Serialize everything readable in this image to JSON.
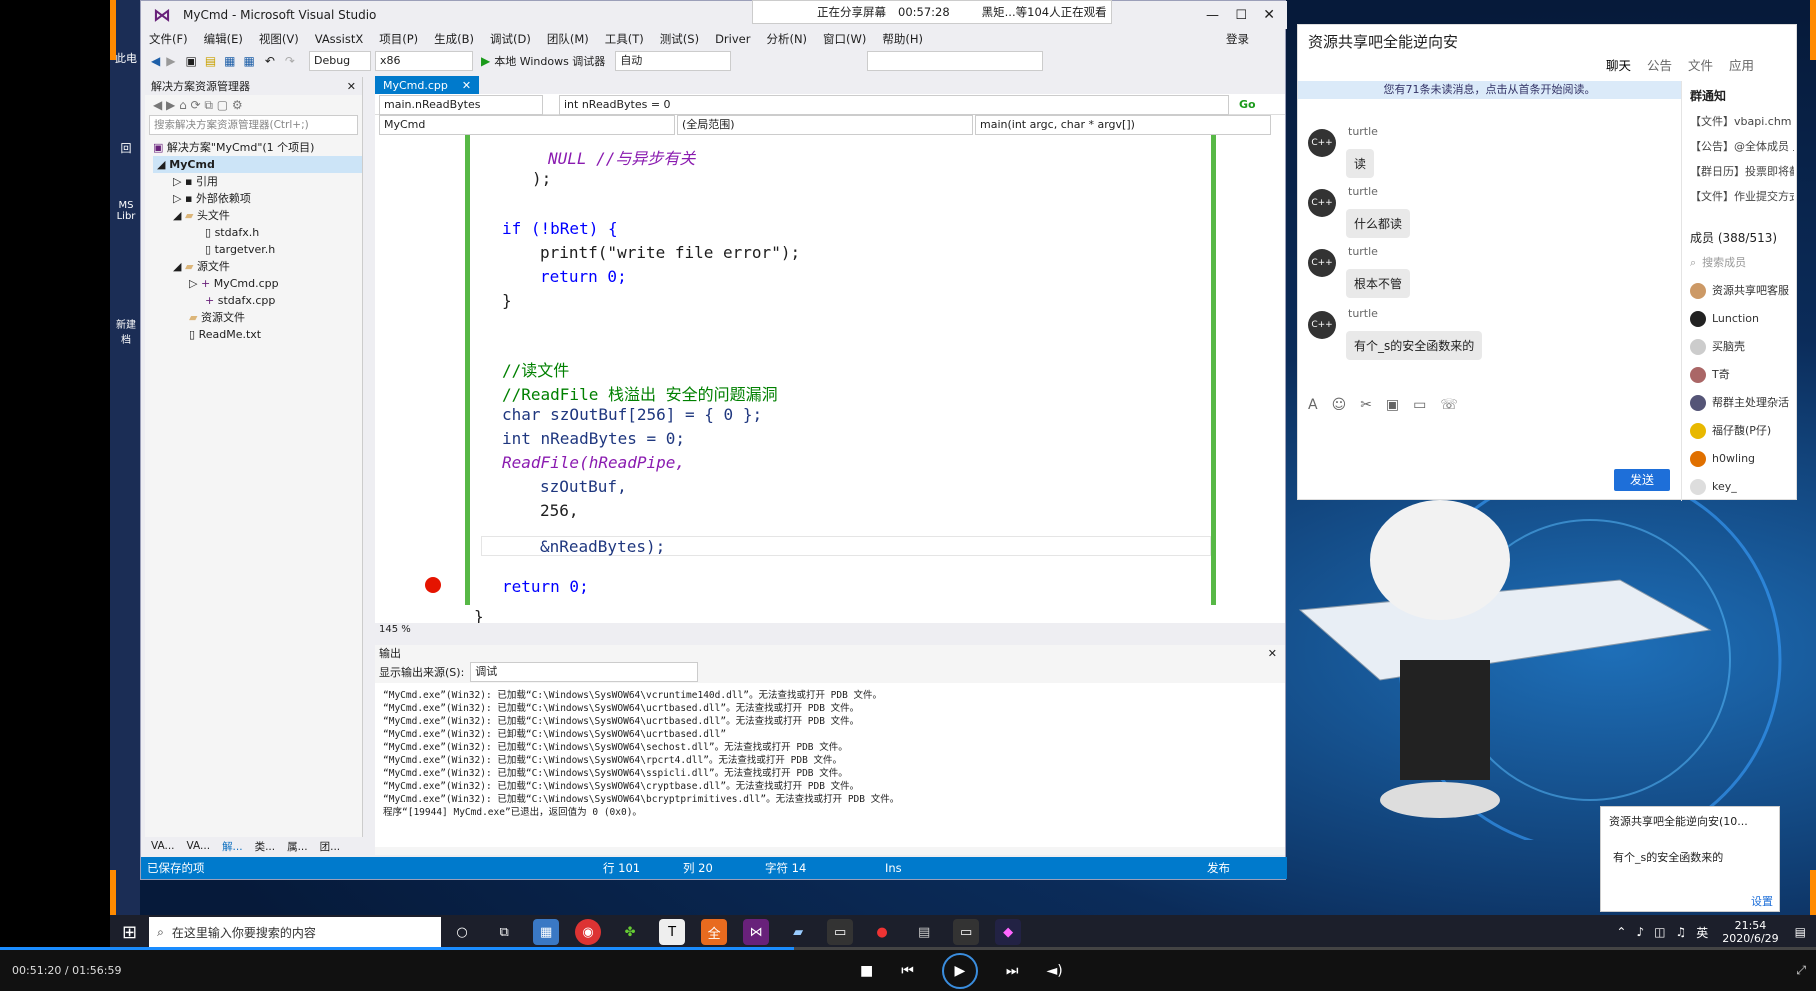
{
  "vs": {
    "title": "MyCmd - Microsoft Visual Studio",
    "menu": [
      "文件(F)",
      "编辑(E)",
      "视图(V)",
      "VAssistX",
      "项目(P)",
      "生成(B)",
      "调试(D)",
      "团队(M)",
      "工具(T)",
      "测试(S)",
      "Driver",
      "分析(N)",
      "窗口(W)",
      "帮助(H)"
    ],
    "login": "登录",
    "toolbar": {
      "config": "Debug",
      "platform": "x86",
      "run": "本地 Windows 调试器",
      "auto": "自动"
    },
    "solution_explorer": {
      "title": "解决方案资源管理器",
      "search_placeholder": "搜索解决方案资源管理器(Ctrl+;)",
      "solution": "解决方案\"MyCmd\"(1 个项目)",
      "project": "MyCmd",
      "refs": "引用",
      "ext_deps": "外部依赖项",
      "header_files": "头文件",
      "stdafx_h": "stdafx.h",
      "targetver_h": "targetver.h",
      "source_files": "源文件",
      "mycmd_cpp": "MyCmd.cpp",
      "stdafx_cpp": "stdafx.cpp",
      "resource_files": "资源文件",
      "readme": "ReadMe.txt",
      "bottom_tabs": [
        "VA...",
        "VA...",
        "解...",
        "类...",
        "属...",
        "团..."
      ]
    },
    "editor": {
      "tab": "MyCmd.cpp",
      "nav_left": "main.nReadBytes",
      "nav_right": "int nReadBytes = 0",
      "go": "Go",
      "scope_project": "MyCmd",
      "scope_global": "(全局范围)",
      "scope_func": "main(int argc, char * argv[])",
      "zoom": "145 %",
      "lines": {
        "l1": "NULL //与异步有关",
        "l2": ");",
        "l3a": "if (!bRet) {",
        "l4": "printf(\"write file error\");",
        "l5": "return 0;",
        "l6": "}",
        "l7": "//读文件",
        "l8": "//ReadFile 栈溢出 安全的问题漏洞",
        "l9": "char szOutBuf[256] = { 0 };",
        "l10": "int nReadBytes = 0;",
        "l11": "ReadFile(hReadPipe,",
        "l12": "szOutBuf,",
        "l13": "256,",
        "l14": "&nReadBytes);",
        "l15": "return 0;",
        "l16": "}"
      }
    },
    "output": {
      "title": "输出",
      "source_label": "显示输出来源(S):",
      "source_value": "调试",
      "lines": [
        "“MyCmd.exe”(Win32): 已加载“C:\\Windows\\SysWOW64\\vcruntime140d.dll”。无法查找或打开 PDB 文件。",
        "“MyCmd.exe”(Win32): 已加载“C:\\Windows\\SysWOW64\\ucrtbased.dll”。无法查找或打开 PDB 文件。",
        "“MyCmd.exe”(Win32): 已加载“C:\\Windows\\SysWOW64\\ucrtbased.dll”。无法查找或打开 PDB 文件。",
        "“MyCmd.exe”(Win32): 已卸载“C:\\Windows\\SysWOW64\\ucrtbased.dll”",
        "“MyCmd.exe”(Win32): 已加载“C:\\Windows\\SysWOW64\\sechost.dll”。无法查找或打开 PDB 文件。",
        "“MyCmd.exe”(Win32): 已加载“C:\\Windows\\SysWOW64\\rpcrt4.dll”。无法查找或打开 PDB 文件。",
        "“MyCmd.exe”(Win32): 已加载“C:\\Windows\\SysWOW64\\sspicli.dll”。无法查找或打开 PDB 文件。",
        "“MyCmd.exe”(Win32): 已加载“C:\\Windows\\SysWOW64\\cryptbase.dll”。无法查找或打开 PDB 文件。",
        "“MyCmd.exe”(Win32): 已加载“C:\\Windows\\SysWOW64\\bcryptprimitives.dll”。无法查找或打开 PDB 文件。",
        "程序“[19944] MyCmd.exe”已退出，返回值为 0 (0x0)。"
      ]
    },
    "status": {
      "left": "已保存的项",
      "row": "行 101",
      "col": "列 20",
      "char": "字符 14",
      "ins": "Ins",
      "publish": "发布"
    }
  },
  "share_bar": {
    "sharing": "正在分享屏幕",
    "time": "00:57:28",
    "viewers": "黑矩...等104人正在观看"
  },
  "chat": {
    "title": "资源共享吧全能逆向安",
    "tabs": [
      "聊天",
      "公告",
      "文件",
      "应用"
    ],
    "unread": "您有71条未读消息，点击从首条开始阅读。",
    "avatar_label": "C++",
    "messages": [
      {
        "name": "turtle",
        "text": "读"
      },
      {
        "name": "turtle",
        "text": "什么都读"
      },
      {
        "name": "turtle",
        "text": "根本不管"
      },
      {
        "name": "turtle",
        "text": "有个_s的安全函数来的"
      }
    ],
    "send": "发送",
    "notice_title": "群通知",
    "notices": [
      "【文件】vbapi.chm",
      "【公告】@全体成员 上课",
      "【群日历】投票即将截止",
      "【文件】作业提交方式.c"
    ],
    "members_title": "成员 (388/513)",
    "member_search": "搜索成员",
    "members": [
      "资源共享吧客服",
      "Lunction",
      "买脑壳",
      "T奇",
      "帮群主处理杂活",
      "福仔馥(P仔)",
      "h0wling",
      "key_"
    ]
  },
  "popup": {
    "title": "资源共享吧全能逆向安(10...",
    "text": "有个_s的安全函数来的",
    "settings": "设置"
  },
  "taskbar": {
    "search": "在这里输入你要搜索的内容",
    "time": "21:54",
    "date": "2020/6/29",
    "ime": "英"
  },
  "player": {
    "time": "00:51:20 / 01:56:59",
    "progress": 0.437
  },
  "desktop_icons": [
    "此电",
    "回",
    "MS Libr",
    "新建 档"
  ]
}
